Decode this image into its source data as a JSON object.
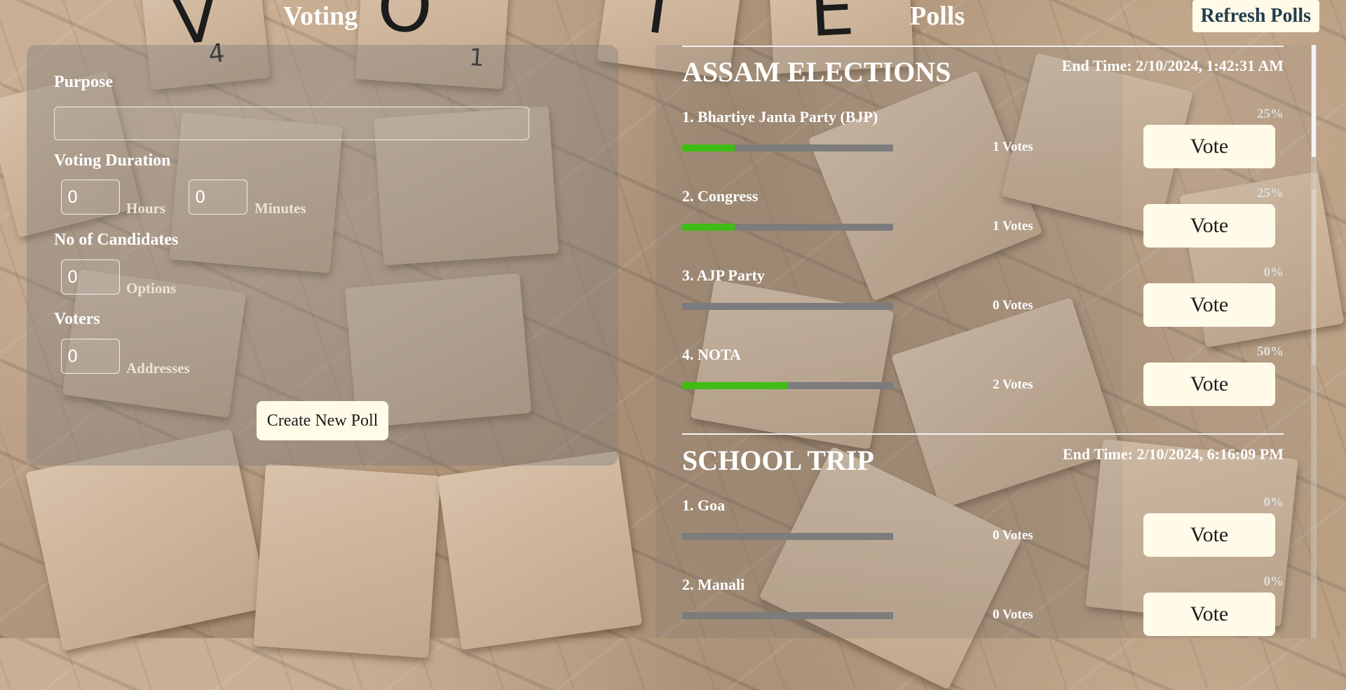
{
  "header": {
    "voting_title": "Voting",
    "polls_title": "Polls",
    "refresh_label": "Refresh Polls"
  },
  "create_form": {
    "purpose_label": "Purpose",
    "purpose_value": "",
    "duration_label": "Voting Duration",
    "hours_value": "0",
    "hours_unit": "Hours",
    "minutes_value": "0",
    "minutes_unit": "Minutes",
    "candidates_label": "No of Candidates",
    "candidates_value": "0",
    "candidates_unit": "Options",
    "voters_label": "Voters",
    "voters_value": "0",
    "voters_unit": "Addresses",
    "create_label": "Create New Poll"
  },
  "polls": [
    {
      "title": "ASSAM ELECTIONS",
      "end_time": "End Time: 2/10/2024, 1:42:31 AM",
      "candidates": [
        {
          "name": "1. Bhartiye Janta Party (BJP)",
          "percent_label": "25%",
          "percent": 25,
          "votes": "1 Votes",
          "vote_label": "Vote"
        },
        {
          "name": "2. Congress",
          "percent_label": "25%",
          "percent": 25,
          "votes": "1 Votes",
          "vote_label": "Vote"
        },
        {
          "name": "3. AJP Party",
          "percent_label": "0%",
          "percent": 0,
          "votes": "0 Votes",
          "vote_label": "Vote"
        },
        {
          "name": "4. NOTA",
          "percent_label": "50%",
          "percent": 50,
          "votes": "2 Votes",
          "vote_label": "Vote"
        }
      ]
    },
    {
      "title": "SCHOOL TRIP",
      "end_time": "End Time: 2/10/2024, 6:16:09 PM",
      "candidates": [
        {
          "name": "1. Goa",
          "percent_label": "0%",
          "percent": 0,
          "votes": "0 Votes",
          "vote_label": "Vote"
        },
        {
          "name": "2. Manali",
          "percent_label": "0%",
          "percent": 0,
          "votes": "0 Votes",
          "vote_label": "Vote"
        }
      ]
    }
  ],
  "background": {
    "tile_letters": [
      "V",
      "4",
      "O",
      "1",
      "T",
      "E"
    ]
  },
  "colors": {
    "bar_fill": "#3fbc15",
    "bar_track": "#7c7c7c",
    "button_bg": "#fffbe8",
    "refresh_text": "#243d4f"
  }
}
